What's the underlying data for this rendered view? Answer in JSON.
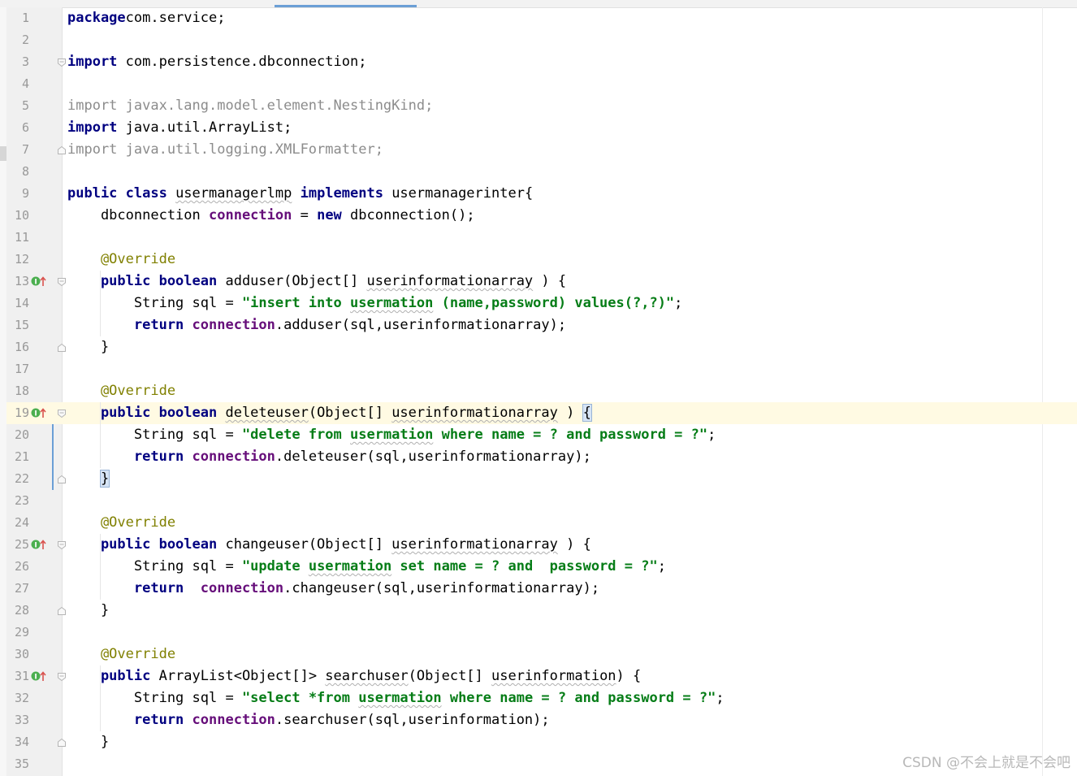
{
  "editor": {
    "current_line": 19,
    "lines": [
      {
        "n": "1",
        "segs": [
          [
            "kw",
            "package"
          ],
          [
            "",
            "com.service;"
          ]
        ]
      },
      {
        "n": "2",
        "segs": []
      },
      {
        "n": "3",
        "fold": "open",
        "segs": [
          [
            "kw",
            "import"
          ],
          [
            "",
            " com.persistence.dbconnection;"
          ]
        ]
      },
      {
        "n": "4",
        "segs": []
      },
      {
        "n": "5",
        "segs": [
          [
            "unused",
            "import javax.lang.model.element.NestingKind;"
          ]
        ]
      },
      {
        "n": "6",
        "segs": [
          [
            "kw",
            "import"
          ],
          [
            "",
            " java.util.ArrayList;"
          ]
        ]
      },
      {
        "n": "7",
        "fold": "close",
        "segs": [
          [
            "unused",
            "import java.util.logging.XMLFormatter;"
          ]
        ]
      },
      {
        "n": "8",
        "segs": []
      },
      {
        "n": "9",
        "segs": [
          [
            "kw",
            "public class "
          ],
          [
            "squig",
            "usermanagerlmp"
          ],
          [
            "kw",
            " implements "
          ],
          [
            "",
            "usermanagerinter{"
          ]
        ]
      },
      {
        "n": "10",
        "segs": [
          [
            "",
            "    dbconnection "
          ],
          [
            "fld",
            "connection"
          ],
          [
            "",
            " = "
          ],
          [
            "kw",
            "new"
          ],
          [
            "",
            " dbconnection();"
          ]
        ]
      },
      {
        "n": "11",
        "segs": []
      },
      {
        "n": "12",
        "segs": [
          [
            "ann",
            "    @Override"
          ]
        ]
      },
      {
        "n": "13",
        "icon": "implements",
        "fold": "open",
        "segs": [
          [
            "kw",
            "    public boolean "
          ],
          [
            "",
            "adduser(Object[] "
          ],
          [
            "squig",
            "userinformationarray"
          ],
          [
            "",
            " ) {"
          ]
        ]
      },
      {
        "n": "14",
        "segs": [
          [
            "",
            "        String sql = "
          ],
          [
            "str",
            "\"insert into "
          ],
          [
            "str squig",
            "usermation"
          ],
          [
            "str",
            " (name,password) values(?,?)\""
          ],
          [
            "",
            ";"
          ]
        ]
      },
      {
        "n": "15",
        "segs": [
          [
            "kw",
            "        return "
          ],
          [
            "fld",
            "connection"
          ],
          [
            "",
            ".adduser(sql,userinformationarray);"
          ]
        ]
      },
      {
        "n": "16",
        "fold": "close",
        "segs": [
          [
            "",
            "    }"
          ]
        ]
      },
      {
        "n": "17",
        "segs": []
      },
      {
        "n": "18",
        "segs": [
          [
            "ann",
            "    @Override"
          ]
        ]
      },
      {
        "n": "19",
        "icon": "implements",
        "fold": "open",
        "segs": [
          [
            "kw",
            "    public boolean "
          ],
          [
            "squig",
            "deleteuser"
          ],
          [
            "",
            "(Object[] "
          ],
          [
            "squig",
            "userinformationarray"
          ],
          [
            "",
            " ) "
          ],
          [
            "brace-match",
            "{"
          ]
        ]
      },
      {
        "n": "20",
        "segs": [
          [
            "",
            "        String sql = "
          ],
          [
            "str",
            "\"delete from "
          ],
          [
            "str squig",
            "usermation"
          ],
          [
            "str",
            " where name = ? and password = ?\""
          ],
          [
            "",
            ";"
          ]
        ]
      },
      {
        "n": "21",
        "segs": [
          [
            "kw",
            "        return "
          ],
          [
            "fld",
            "connection"
          ],
          [
            "",
            ".deleteuser(sql,userinformationarray);"
          ]
        ]
      },
      {
        "n": "22",
        "fold": "close",
        "segs": [
          [
            "",
            "    "
          ],
          [
            "brace-match",
            "}"
          ]
        ]
      },
      {
        "n": "23",
        "segs": []
      },
      {
        "n": "24",
        "segs": [
          [
            "ann",
            "    @Override"
          ]
        ]
      },
      {
        "n": "25",
        "icon": "implements",
        "fold": "open",
        "segs": [
          [
            "kw",
            "    public boolean "
          ],
          [
            "",
            "changeuser(Object[] "
          ],
          [
            "squig",
            "userinformationarray"
          ],
          [
            "",
            " ) {"
          ]
        ]
      },
      {
        "n": "26",
        "segs": [
          [
            "",
            "        String sql = "
          ],
          [
            "str",
            "\"update "
          ],
          [
            "str squig",
            "usermation"
          ],
          [
            "str",
            " set name = ? and  password = ?\""
          ],
          [
            "",
            ";"
          ]
        ]
      },
      {
        "n": "27",
        "segs": [
          [
            "kw",
            "        return  "
          ],
          [
            "fld",
            "connection"
          ],
          [
            "",
            ".changeuser(sql,userinformationarray);"
          ]
        ]
      },
      {
        "n": "28",
        "fold": "close",
        "segs": [
          [
            "",
            "    }"
          ]
        ]
      },
      {
        "n": "29",
        "segs": []
      },
      {
        "n": "30",
        "segs": [
          [
            "ann",
            "    @Override"
          ]
        ]
      },
      {
        "n": "31",
        "icon": "implements",
        "fold": "open",
        "segs": [
          [
            "kw",
            "    public "
          ],
          [
            "",
            "ArrayList<Object[]> "
          ],
          [
            "squig",
            "searchuser"
          ],
          [
            "",
            "(Object[] "
          ],
          [
            "squig",
            "userinformation"
          ],
          [
            "",
            ") {"
          ]
        ]
      },
      {
        "n": "32",
        "segs": [
          [
            "",
            "        String sql = "
          ],
          [
            "str",
            "\"select *from "
          ],
          [
            "str squig",
            "usermation"
          ],
          [
            "str",
            " where name = ? and password = ?\""
          ],
          [
            "",
            ";"
          ]
        ]
      },
      {
        "n": "33",
        "segs": [
          [
            "kw",
            "        return "
          ],
          [
            "fld",
            "connection"
          ],
          [
            "",
            ".searchuser(sql,userinformation);"
          ]
        ]
      },
      {
        "n": "34",
        "fold": "close",
        "segs": [
          [
            "",
            "    }"
          ]
        ]
      },
      {
        "n": "35",
        "segs": []
      }
    ]
  },
  "colors": {
    "keyword": "#000080",
    "string": "#067d17",
    "field": "#660e7a",
    "annotation": "#808000",
    "unused_import": "#8c8c8c",
    "line_number": "#999999",
    "current_line_bg": "#fffae3",
    "implements_icon": "#4caf50"
  },
  "icons": {
    "implements": "implements-method-icon",
    "fold_open": "fold-open-icon",
    "fold_close": "fold-close-icon"
  },
  "watermark": "CSDN @不会上就是不会吧"
}
